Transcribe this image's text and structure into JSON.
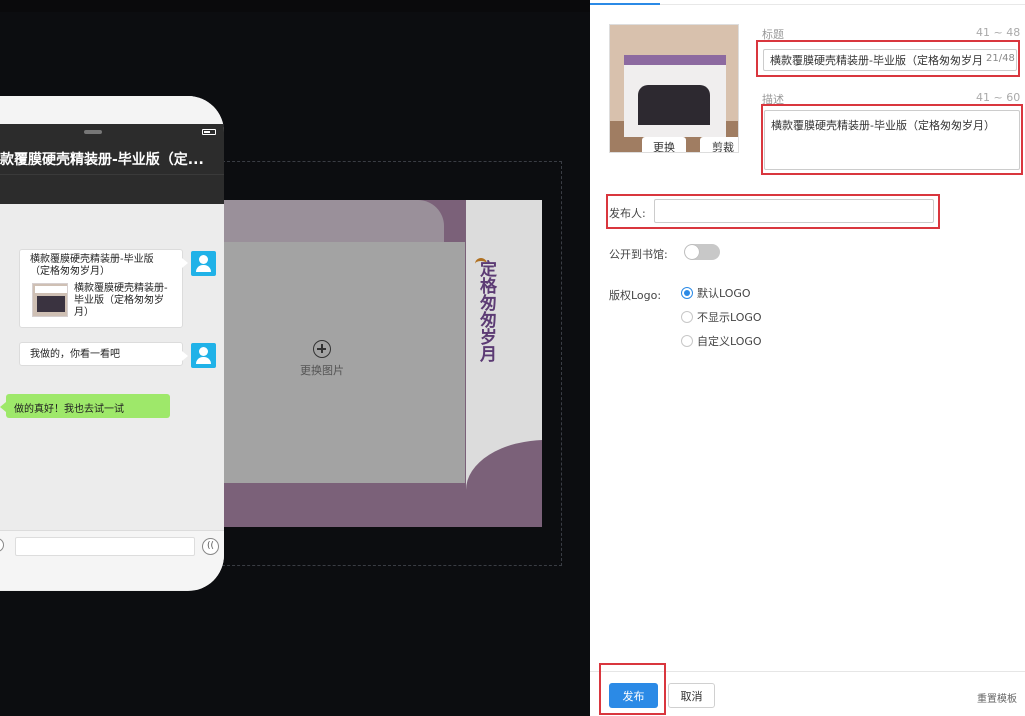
{
  "phone": {
    "title": "款覆膜硬壳精装册-毕业版（定...",
    "messages": {
      "share_title": "横款覆膜硬壳精装册-毕业版（定格匆匆岁月）",
      "share_desc": "横款覆膜硬壳精装册-毕业版（定格匆匆岁月）",
      "reply": "我做的，你看一看吧",
      "friend": "做的真好！我也去试一试"
    }
  },
  "canvas": {
    "replace_image": "更换图片",
    "cover_vertical_title": "定格匆匆岁月"
  },
  "panel": {
    "cover": {
      "replace_label": "更换",
      "crop_label": "剪裁"
    },
    "title_field": {
      "label": "标题",
      "range": "41 ~ 48",
      "value": "横款覆膜硬壳精装册-毕业版（定格匆匆岁月）",
      "count": "21/48"
    },
    "desc_field": {
      "label": "描述",
      "range": "41 ~ 60",
      "value": "横款覆膜硬壳精装册-毕业版（定格匆匆岁月）"
    },
    "publisher": {
      "label": "发布人:",
      "value": ""
    },
    "library": {
      "label": "公开到书馆:",
      "on": false
    },
    "logo": {
      "label": "版权Logo:",
      "options": [
        "默认LOGO",
        "不显示LOGO",
        "自定义LOGO"
      ],
      "selected": "默认LOGO"
    },
    "footer": {
      "publish_label": "发布",
      "cancel_label": "取消",
      "reset_label": "重置模板"
    }
  },
  "colors": {
    "accent": "#2b8ae6",
    "highlight": "#d9363e",
    "bubble_green": "#9ee86a",
    "avatar_blue": "#20b2e8",
    "cover_purple": "#7b6179"
  }
}
